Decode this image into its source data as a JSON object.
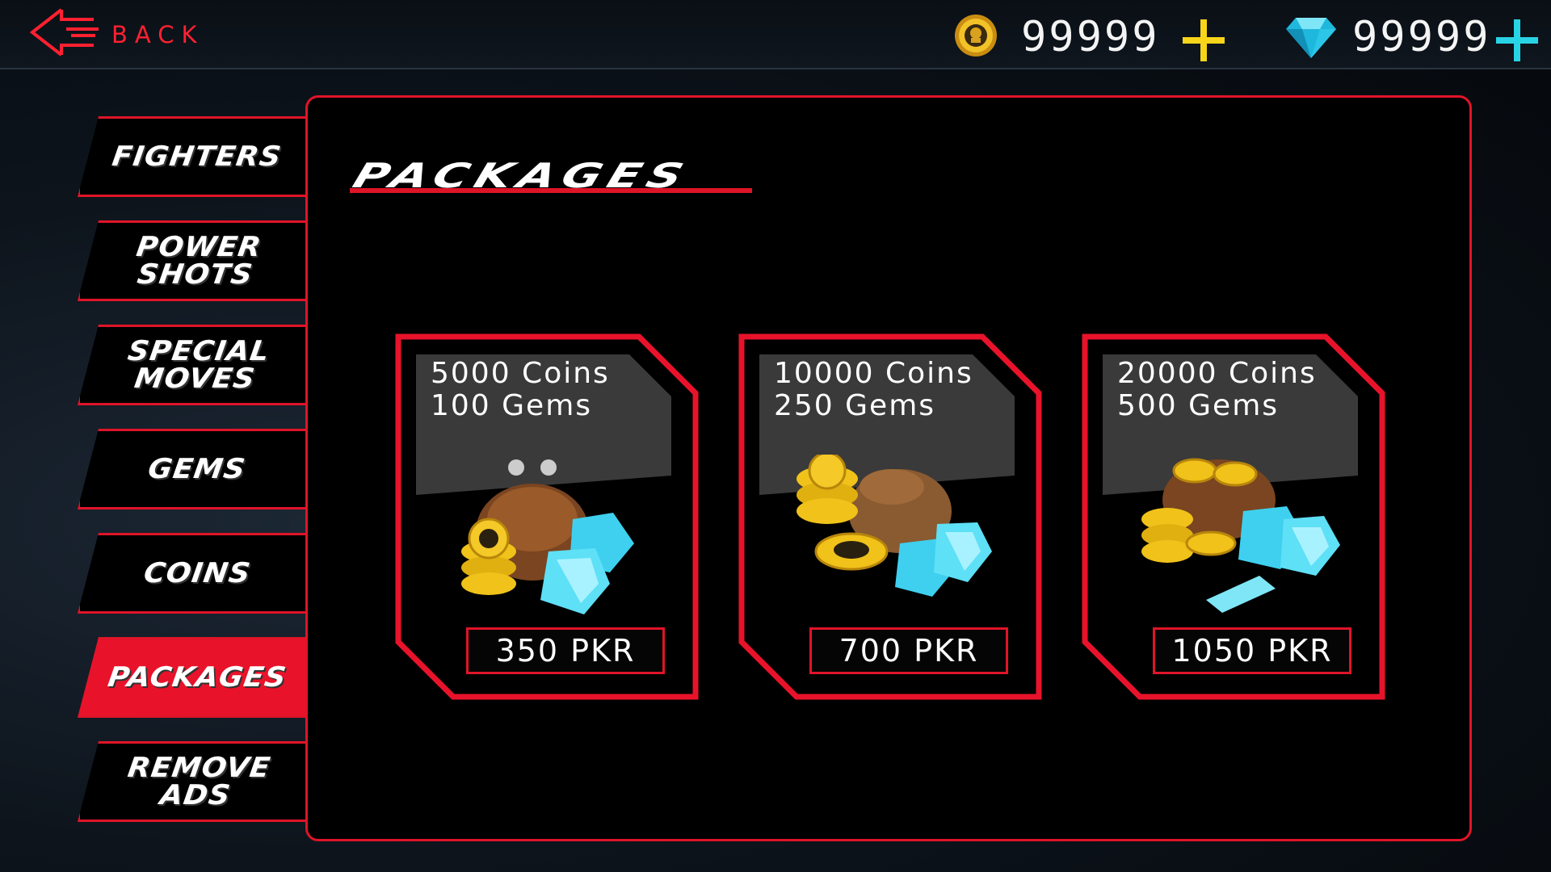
{
  "header": {
    "back_label": "BACK",
    "coins_amount": "99999",
    "gems_amount": "99999",
    "icons": {
      "back": "back-arrow-icon",
      "coin": "coin-icon",
      "gem": "gem-icon",
      "add": "plus-icon"
    },
    "colors": {
      "coin_plus": "#f7d51a",
      "gem_plus": "#29d3e6",
      "accent": "#e01428"
    }
  },
  "sidebar": {
    "items": [
      {
        "label": "FIGHTERS",
        "active": false
      },
      {
        "label": "POWER\nSHOTS",
        "active": false
      },
      {
        "label": "SPECIAL\nMOVES",
        "active": false
      },
      {
        "label": "GEMS",
        "active": false
      },
      {
        "label": "COINS",
        "active": false
      },
      {
        "label": "PACKAGES",
        "active": true
      },
      {
        "label": "REMOVE\nADS",
        "active": false
      }
    ]
  },
  "main": {
    "title": "PACKAGES",
    "packages": [
      {
        "coins": "5000 Coins",
        "gems": "100 Gems",
        "price": "350 PKR",
        "art": "coin-purse-gems-icon"
      },
      {
        "coins": "10000 Coins",
        "gems": "250 Gems",
        "price": "700 PKR",
        "art": "coin-sack-gems-icon"
      },
      {
        "coins": "20000 Coins",
        "gems": "500 Gems",
        "price": "1050 PKR",
        "art": "treasure-bag-gems-icon"
      }
    ]
  }
}
